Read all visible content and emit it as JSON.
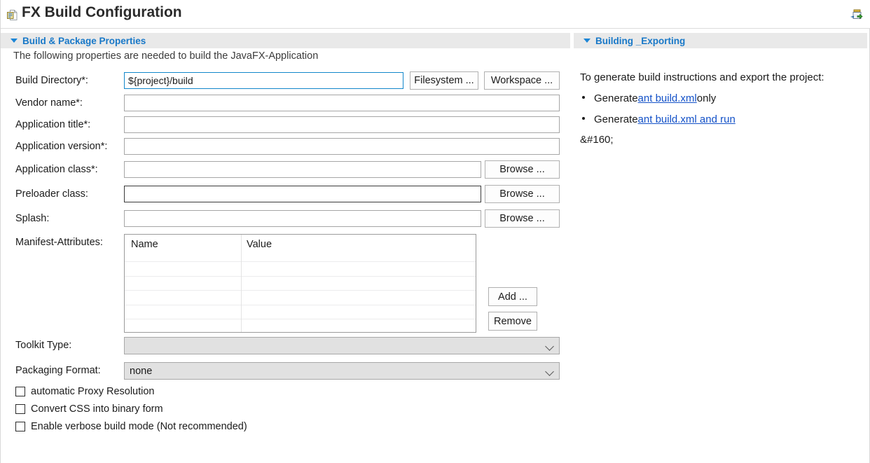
{
  "window": {
    "title": "FX Build Configuration",
    "title_icon": "build-config-document-icon",
    "export_icon": "export-wizard-icon"
  },
  "left_section": {
    "header": "Build & Package Properties",
    "description": "The following properties are needed to build the JavaFX-Application",
    "fields": [
      {
        "label": "Build Directory*:",
        "value": "${project}/build",
        "placeholder": ""
      },
      {
        "label": "Vendor name*:",
        "value": "",
        "placeholder": ""
      },
      {
        "label": "Application title*:",
        "value": "",
        "placeholder": ""
      },
      {
        "label": "Application version*:",
        "value": "",
        "placeholder": ""
      },
      {
        "label": "Application class*:",
        "value": "",
        "placeholder": ""
      },
      {
        "label": "Preloader class:",
        "value": "",
        "placeholder": ""
      },
      {
        "label": "Splash:",
        "value": "",
        "placeholder": ""
      }
    ],
    "buttons": {
      "filesystem": "Filesystem ...",
      "workspace": "Workspace ...",
      "browse_app_class": "Browse ...",
      "browse_preloader": "Browse ...",
      "browse_splash": "Browse ...",
      "add": "Add ...",
      "remove": "Remove"
    },
    "manifest": {
      "label": "Manifest-Attributes:",
      "columns": [
        "Name",
        "Value"
      ],
      "rows": [
        [
          "",
          ""
        ],
        [
          "",
          ""
        ],
        [
          "",
          ""
        ],
        [
          "",
          ""
        ],
        [
          "",
          ""
        ]
      ]
    },
    "combos": [
      {
        "label": "Toolkit Type:",
        "value": ""
      },
      {
        "label": "Packaging Format:",
        "value": "none"
      }
    ],
    "checkboxes": [
      {
        "label": "automatic Proxy Resolution",
        "checked": false
      },
      {
        "label": "Convert CSS into binary form",
        "checked": false
      },
      {
        "label": "Enable verbose build mode (Not recommended)",
        "checked": false
      }
    ]
  },
  "right_section": {
    "header": "Building _Exporting",
    "intro": "To generate build instructions and export the project:",
    "bullets": [
      {
        "pre": "Generate ",
        "link": "ant build.xml",
        "post": " only"
      },
      {
        "pre": "Generate ",
        "link": "ant build.xml and run",
        "post": ""
      }
    ],
    "trailing": "&#160;"
  },
  "colors": {
    "accent_blue": "#1878c8",
    "link_blue": "#1452c8",
    "section_bar": "#e9e9e9",
    "focus_border": "#1287cb",
    "combo_fill": "#e1e1e1"
  }
}
